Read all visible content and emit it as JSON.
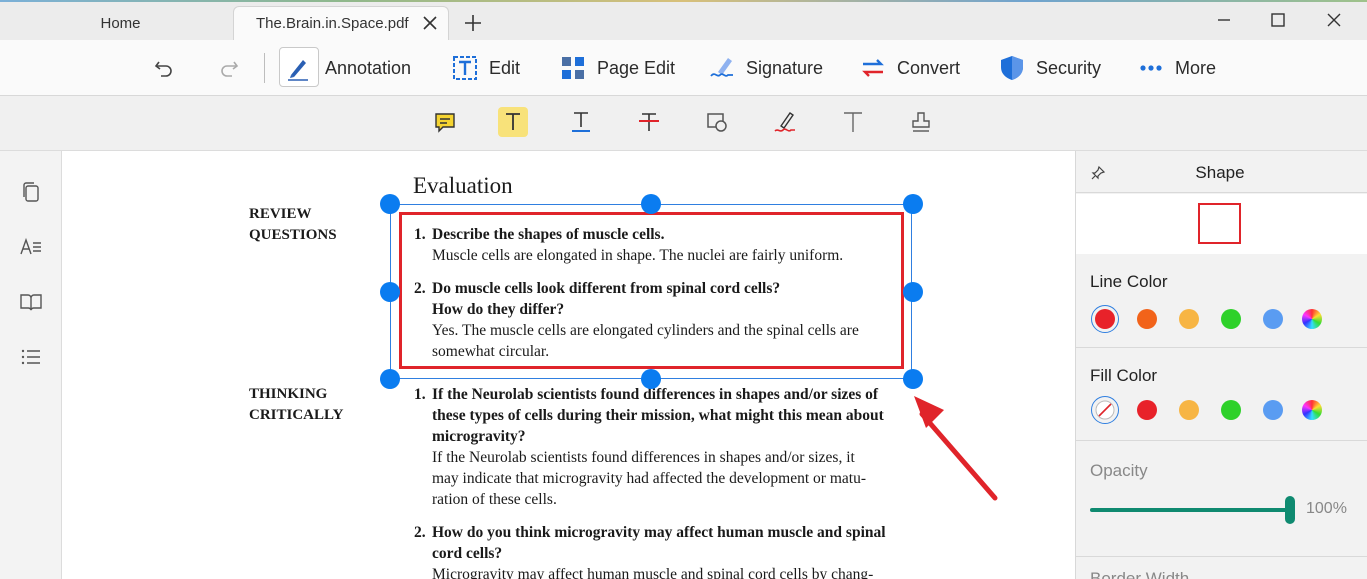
{
  "tabs": {
    "home_label": "Home",
    "active_label": "The.Brain.in.Space.pdf"
  },
  "toolbar": {
    "annotation_label": "Annotation",
    "edit_label": "Edit",
    "page_edit_label": "Page Edit",
    "signature_label": "Signature",
    "convert_label": "Convert",
    "security_label": "Security",
    "more_label": "More"
  },
  "document": {
    "heading": "Evaluation",
    "review_label_1": "REVIEW",
    "review_label_2": "QUESTIONS",
    "thinking_label_1": "THINKING",
    "thinking_label_2": "CRITICALLY",
    "review_questions": [
      {
        "number": "1.",
        "question": [
          "Describe the shapes of muscle cells."
        ],
        "answer": [
          "Muscle cells are elongated in shape. The nuclei are fairly uniform."
        ]
      },
      {
        "number": "2.",
        "question": [
          "Do muscle cells look different from spinal cord cells?",
          "How do they differ?"
        ],
        "answer": [
          "Yes. The muscle cells are elongated cylinders and the spinal cells are",
          "somewhat circular."
        ]
      }
    ],
    "thinking_questions": [
      {
        "number": "1.",
        "question": [
          "If the Neurolab scientists found differences in shapes and/or sizes of",
          "these types of cells during their mission, what might this mean about",
          "microgravity?"
        ],
        "answer": [
          "If the Neurolab scientists found differences in shapes and/or sizes, it",
          "may indicate that microgravity had affected the development or matu-",
          "ration of these cells."
        ]
      },
      {
        "number": "2.",
        "question": [
          "How do you think microgravity may affect human muscle and spinal",
          "cord cells?"
        ],
        "answer": [
          "Microgravity may affect human muscle and spinal cord cells by chang-"
        ]
      }
    ]
  },
  "panel": {
    "title": "Shape",
    "line_color_label": "Line Color",
    "fill_color_label": "Fill Color",
    "opacity_label": "Opacity",
    "opacity_value": "100%",
    "opacity_fraction": 1.0,
    "border_width_label": "Border Width",
    "line_colors": [
      "#e8222a",
      "#f2631a",
      "#f7b544",
      "#2ed12a",
      "#5a9cf2",
      "rainbow"
    ],
    "fill_colors": [
      "none",
      "#e8222a",
      "#f7b544",
      "#2ed12a",
      "#5a9cf2",
      "rainbow"
    ],
    "selected_line_color": "#e8222a"
  },
  "colors": {
    "accent_blue": "#0a7cf0",
    "shape_red": "#e0242a",
    "slider_green": "#0f8a70",
    "highlight_yellow": "#f8e27a"
  }
}
